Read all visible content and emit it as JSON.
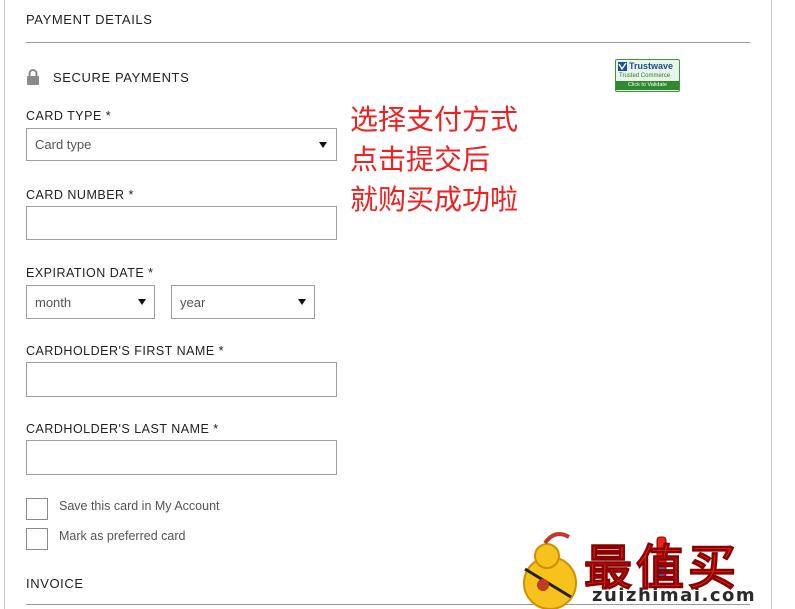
{
  "payment": {
    "title": "PAYMENT DETAILS",
    "secure_label": "SECURE PAYMENTS",
    "trustwave": {
      "brand": "Trustwave",
      "subtitle": "Trusted Commerce",
      "cta": "Click to Validate"
    }
  },
  "form": {
    "card_type": {
      "label": "CARD TYPE *",
      "value": "Card type"
    },
    "card_number": {
      "label": "CARD NUMBER *",
      "value": ""
    },
    "expiration": {
      "label": "EXPIRATION DATE *",
      "month": "month",
      "year": "year"
    },
    "first_name": {
      "label": "CARDHOLDER'S FIRST NAME *",
      "value": ""
    },
    "last_name": {
      "label": "CARDHOLDER'S LAST NAME *",
      "value": ""
    },
    "save_card": {
      "label": "Save this card in My Account",
      "checked": false
    },
    "preferred_card": {
      "label": "Mark as preferred card",
      "checked": false
    }
  },
  "invoice": {
    "title": "INVOICE"
  },
  "annotation": {
    "line1": "选择支付方式",
    "line2": "点击提交后",
    "line3": "就购买成功啦"
  },
  "watermark": {
    "text": "最值买",
    "domain": "zuizhimai.com"
  },
  "colors": {
    "annotation": "#ee2020",
    "border": "#9e9e9e",
    "trustwave_green": "#2f8a2f"
  }
}
